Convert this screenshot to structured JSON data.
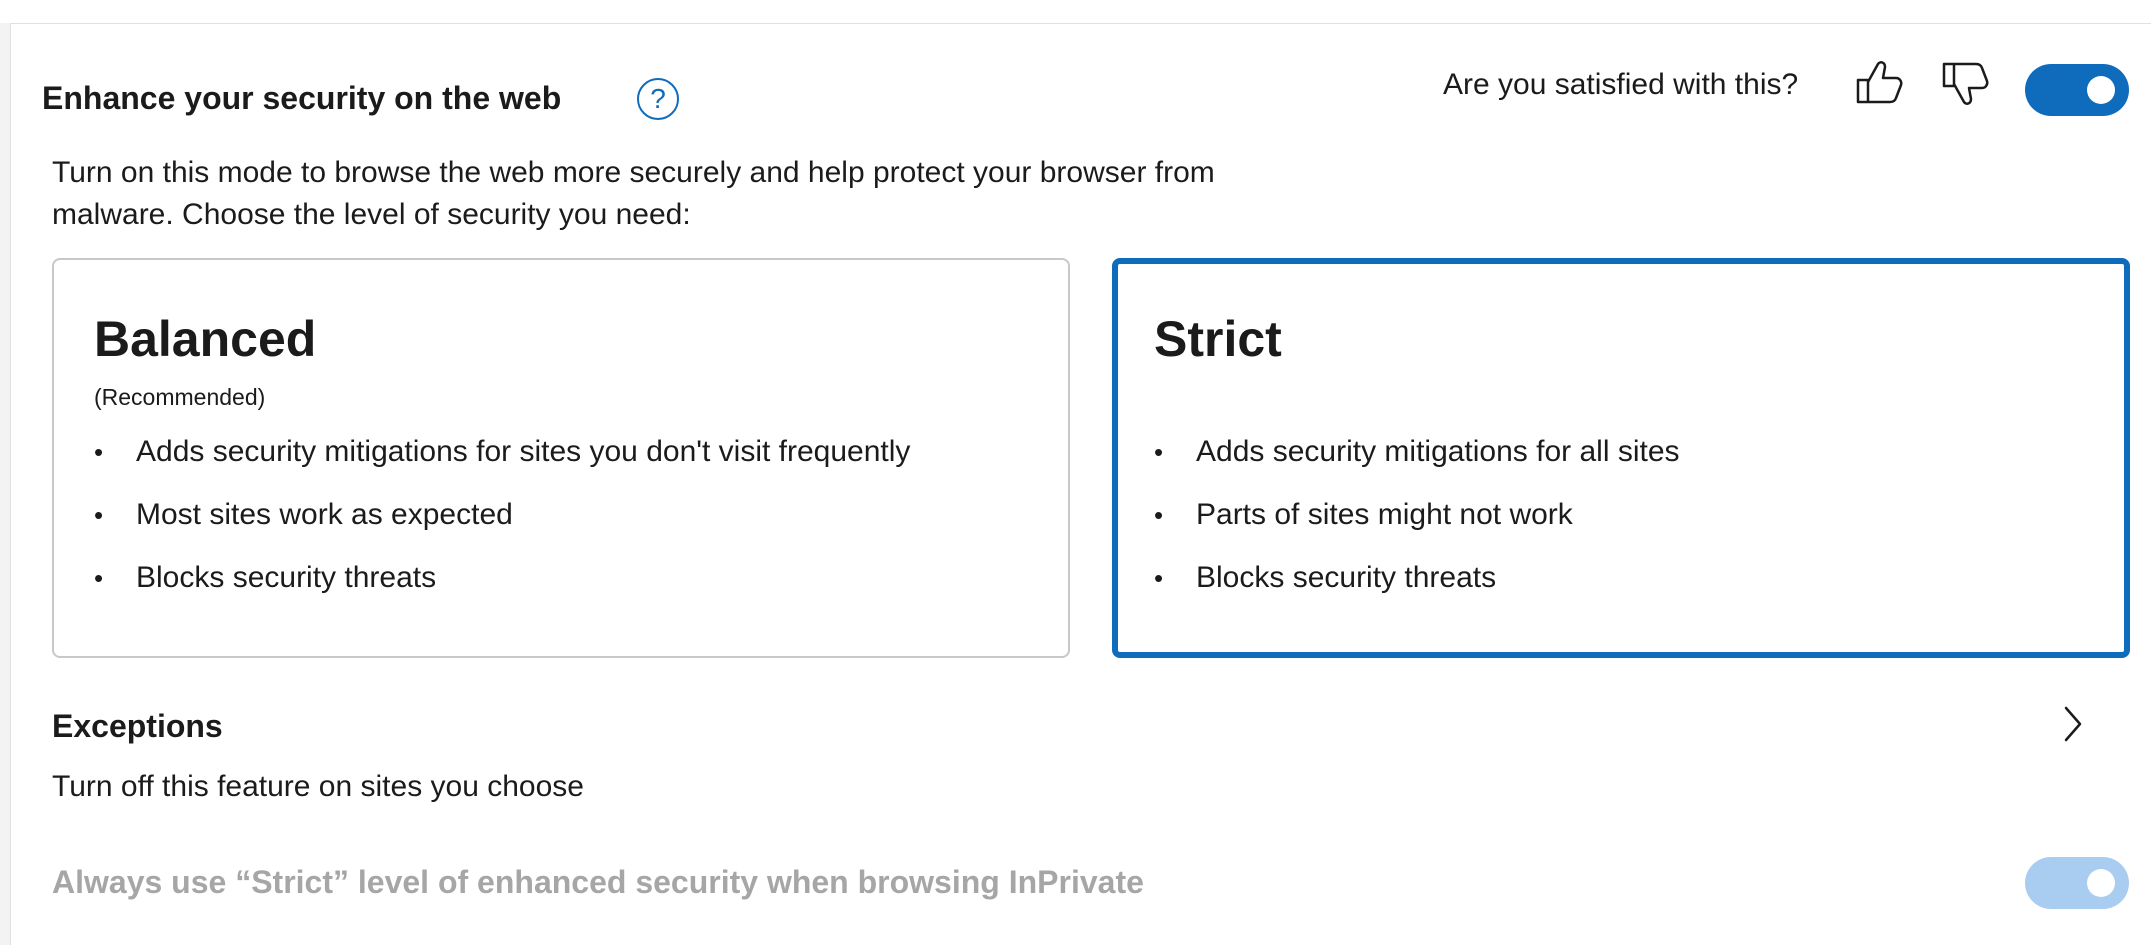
{
  "section": {
    "title": "Enhance your security on the web",
    "help_icon": "question-circle-icon",
    "description_line1": "Turn on this mode to browse the web more securely and help protect your browser from",
    "description_line2": "malware. Choose the level of security you need:"
  },
  "feedback": {
    "prompt": "Are you satisfied with this?",
    "thumbs_up_icon": "thumbs-up-icon",
    "thumbs_down_icon": "thumbs-down-icon"
  },
  "main_toggle": {
    "state": "on",
    "color": "#0f6cbd"
  },
  "cards": {
    "balanced": {
      "title": "Balanced",
      "subtitle": "(Recommended)",
      "bullets": [
        "Adds security mitigations for sites you don't visit frequently",
        "Most sites work as expected",
        "Blocks security threats"
      ]
    },
    "strict": {
      "title": "Strict",
      "selected": true,
      "bullets": [
        "Adds security mitigations for all sites",
        "Parts of sites might not work",
        "Blocks security threats"
      ]
    }
  },
  "exceptions": {
    "title": "Exceptions",
    "description": "Turn off this feature on sites you choose",
    "chevron_icon": "chevron-right-icon"
  },
  "inprivate": {
    "label": "Always use “Strict” level of enhanced security when browsing InPrivate",
    "toggle_state": "on-disabled",
    "color": "#a8cdf0"
  },
  "colors": {
    "accent": "#0f6cbd",
    "disabled_text": "#a6a6a6"
  }
}
